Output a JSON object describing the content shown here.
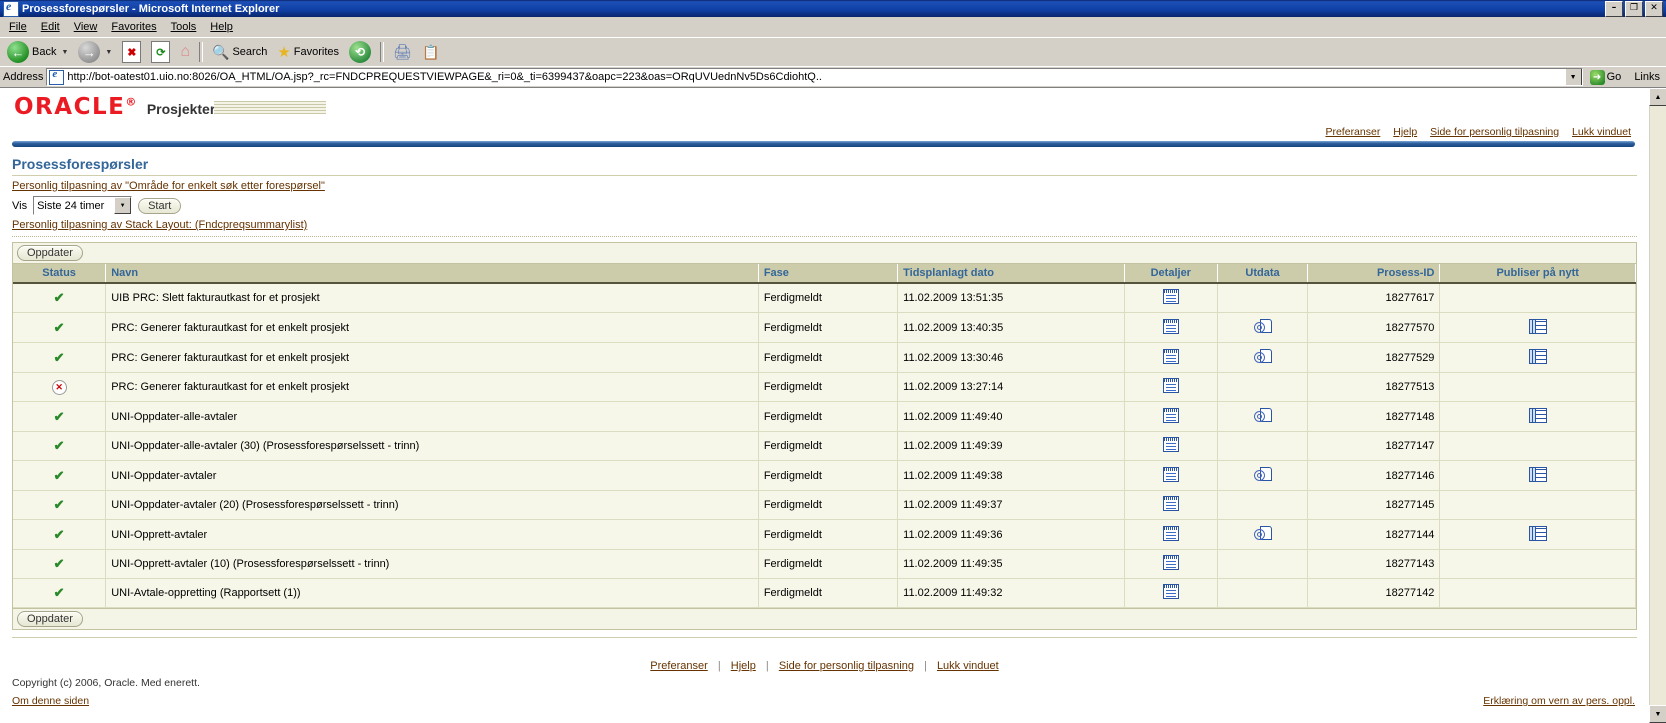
{
  "window": {
    "title": "Prosessforespørsler - Microsoft Internet Explorer",
    "app_icon": "ie-document-icon",
    "minimize": "–",
    "restore": "❐",
    "close": "✕"
  },
  "menu": {
    "items": [
      {
        "label": "File",
        "accel": "F"
      },
      {
        "label": "Edit",
        "accel": "E"
      },
      {
        "label": "View",
        "accel": "V"
      },
      {
        "label": "Favorites",
        "accel": "a"
      },
      {
        "label": "Tools",
        "accel": "T"
      },
      {
        "label": "Help",
        "accel": "H"
      }
    ]
  },
  "toolbar": {
    "back_label": "Back",
    "search_label": "Search",
    "favorites_label": "Favorites",
    "icons": [
      "back-icon",
      "forward-icon",
      "stop-icon",
      "refresh-icon",
      "home-icon",
      "search-icon",
      "favorites-icon",
      "history-icon",
      "print-icon",
      "edit-icon"
    ]
  },
  "address": {
    "label": "Address",
    "url": "http://bot-oatest01.uio.no:8026/OA_HTML/OA.jsp?_rc=FNDCPREQUESTVIEWPAGE&_ri=0&_ti=6399437&oapc=223&oas=ORqUVUednNv5Ds6CdiohtQ..",
    "go_label": "Go",
    "links_label": "Links"
  },
  "brand": {
    "logo": "ORACLE",
    "logo_mark": "®",
    "app_name": "Prosjekter"
  },
  "global_links": [
    {
      "label": "Preferanser"
    },
    {
      "label": "Hjelp"
    },
    {
      "label": "Side for personlig tilpasning"
    },
    {
      "label": "Lukk vinduet"
    }
  ],
  "page": {
    "title": "Prosessforespørsler",
    "personalize_search_link": "Personlig tilpasning av \"Område for enkelt søk etter forespørsel\"",
    "personalize_stack_link": "Personlig tilpasning av Stack Layout: (Fndcpreqsummarylist)",
    "vis_label": "Vis",
    "vis_value": "Siste 24 timer",
    "start_button": "Start",
    "refresh_button_top": "Oppdater",
    "refresh_button_bottom": "Oppdater"
  },
  "table": {
    "columns": [
      {
        "key": "status",
        "label": "Status",
        "align": "center"
      },
      {
        "key": "navn",
        "label": "Navn",
        "align": "left"
      },
      {
        "key": "fase",
        "label": "Fase",
        "align": "left"
      },
      {
        "key": "dato",
        "label": "Tidsplanlagt dato",
        "align": "left"
      },
      {
        "key": "detaljer",
        "label": "Detaljer",
        "align": "center"
      },
      {
        "key": "utdata",
        "label": "Utdata",
        "align": "center"
      },
      {
        "key": "prosess_id",
        "label": "Prosess-ID",
        "align": "right"
      },
      {
        "key": "publiser",
        "label": "Publiser på nytt",
        "align": "center"
      }
    ],
    "rows": [
      {
        "status": "ok",
        "status_icon": "check-icon",
        "navn": "UIB PRC: Slett fakturautkast for et prosjekt",
        "fase": "Ferdigmeldt",
        "dato": "11.02.2009 13:51:35",
        "detaljer": true,
        "utdata": false,
        "prosess_id": "18277617",
        "publiser": false
      },
      {
        "status": "ok",
        "status_icon": "check-icon",
        "navn": "PRC: Generer fakturautkast for et enkelt prosjekt",
        "fase": "Ferdigmeldt",
        "dato": "11.02.2009 13:40:35",
        "detaljer": true,
        "utdata": true,
        "prosess_id": "18277570",
        "publiser": true
      },
      {
        "status": "ok",
        "status_icon": "check-icon",
        "navn": "PRC: Generer fakturautkast for et enkelt prosjekt",
        "fase": "Ferdigmeldt",
        "dato": "11.02.2009 13:30:46",
        "detaljer": true,
        "utdata": true,
        "prosess_id": "18277529",
        "publiser": true
      },
      {
        "status": "error",
        "status_icon": "error-icon",
        "navn": "PRC: Generer fakturautkast for et enkelt prosjekt",
        "fase": "Ferdigmeldt",
        "dato": "11.02.2009 13:27:14",
        "detaljer": true,
        "utdata": false,
        "prosess_id": "18277513",
        "publiser": false
      },
      {
        "status": "ok",
        "status_icon": "check-icon",
        "navn": "UNI-Oppdater-alle-avtaler",
        "fase": "Ferdigmeldt",
        "dato": "11.02.2009 11:49:40",
        "detaljer": true,
        "utdata": true,
        "prosess_id": "18277148",
        "publiser": true
      },
      {
        "status": "ok",
        "status_icon": "check-icon",
        "navn": "UNI-Oppdater-alle-avtaler (30) (Prosessforespørselssett - trinn)",
        "fase": "Ferdigmeldt",
        "dato": "11.02.2009 11:49:39",
        "detaljer": true,
        "utdata": false,
        "prosess_id": "18277147",
        "publiser": false
      },
      {
        "status": "ok",
        "status_icon": "check-icon",
        "navn": "UNI-Oppdater-avtaler",
        "fase": "Ferdigmeldt",
        "dato": "11.02.2009 11:49:38",
        "detaljer": true,
        "utdata": true,
        "prosess_id": "18277146",
        "publiser": true
      },
      {
        "status": "ok",
        "status_icon": "check-icon",
        "navn": "UNI-Oppdater-avtaler (20) (Prosessforespørselssett - trinn)",
        "fase": "Ferdigmeldt",
        "dato": "11.02.2009 11:49:37",
        "detaljer": true,
        "utdata": false,
        "prosess_id": "18277145",
        "publiser": false
      },
      {
        "status": "ok",
        "status_icon": "check-icon",
        "navn": "UNI-Opprett-avtaler",
        "fase": "Ferdigmeldt",
        "dato": "11.02.2009 11:49:36",
        "detaljer": true,
        "utdata": true,
        "prosess_id": "18277144",
        "publiser": true
      },
      {
        "status": "ok",
        "status_icon": "check-icon",
        "navn": "UNI-Opprett-avtaler (10) (Prosessforespørselssett - trinn)",
        "fase": "Ferdigmeldt",
        "dato": "11.02.2009 11:49:35",
        "detaljer": true,
        "utdata": false,
        "prosess_id": "18277143",
        "publiser": false
      },
      {
        "status": "ok",
        "status_icon": "check-icon",
        "navn": "UNI-Avtale-oppretting (Rapportsett (1))",
        "fase": "Ferdigmeldt",
        "dato": "11.02.2009 11:49:32",
        "detaljer": true,
        "utdata": false,
        "prosess_id": "18277142",
        "publiser": false
      }
    ]
  },
  "footer": {
    "links": [
      {
        "label": "Preferanser"
      },
      {
        "label": "Hjelp"
      },
      {
        "label": "Side for personlig tilpasning"
      },
      {
        "label": "Lukk vinduet"
      }
    ],
    "separator": "|",
    "copyright": "Copyright (c) 2006, Oracle. Med enerett.",
    "about_link": "Om denne siden",
    "privacy_link": "Erklæring om vern av pers. oppl."
  },
  "colors": {
    "oracle_red": "#ea1b22",
    "header_blue": "#336699",
    "link_brown": "#663300",
    "table_header_bg": "#ccccaa",
    "table_row_bg": "#f6f6e9",
    "status_ok": "#2a8a2a",
    "status_error": "#cc0000"
  }
}
